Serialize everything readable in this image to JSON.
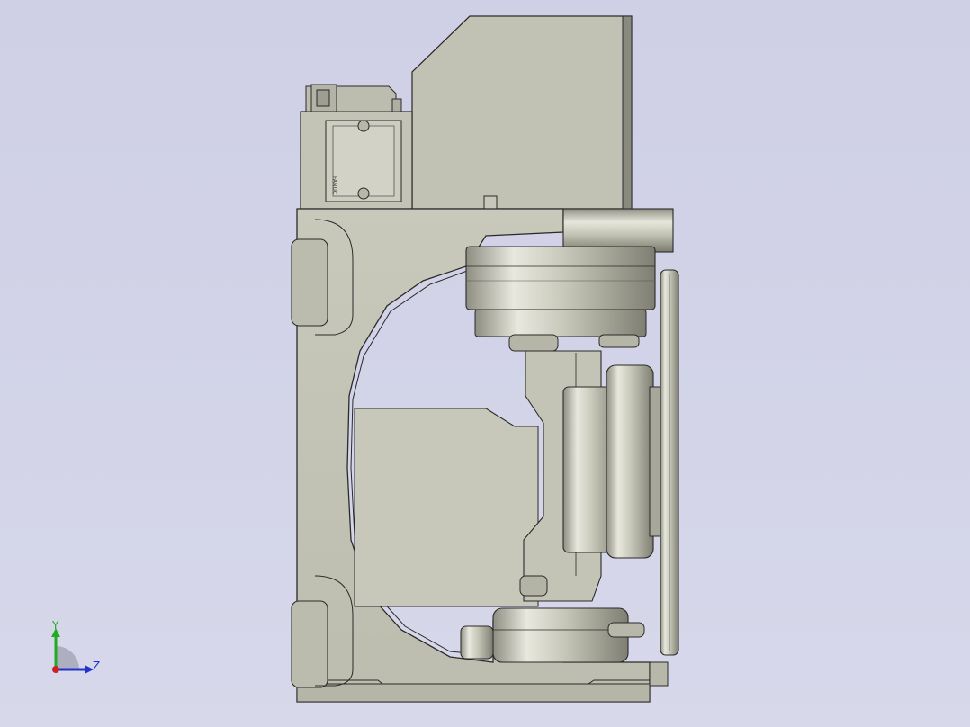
{
  "viewport": {
    "background_top": "#cfd0e6",
    "background_bottom": "#d7d8ea"
  },
  "model": {
    "body_color": "#c6c6b8",
    "body_shadow": "#a8a89a",
    "outline_color": "#2a2a2a",
    "engraved_label": "FANUC"
  },
  "triad": {
    "y_label": "Y",
    "z_label": "Z",
    "y_color": "#22aa22",
    "z_color": "#2233cc",
    "x_color": "#cc2222"
  }
}
